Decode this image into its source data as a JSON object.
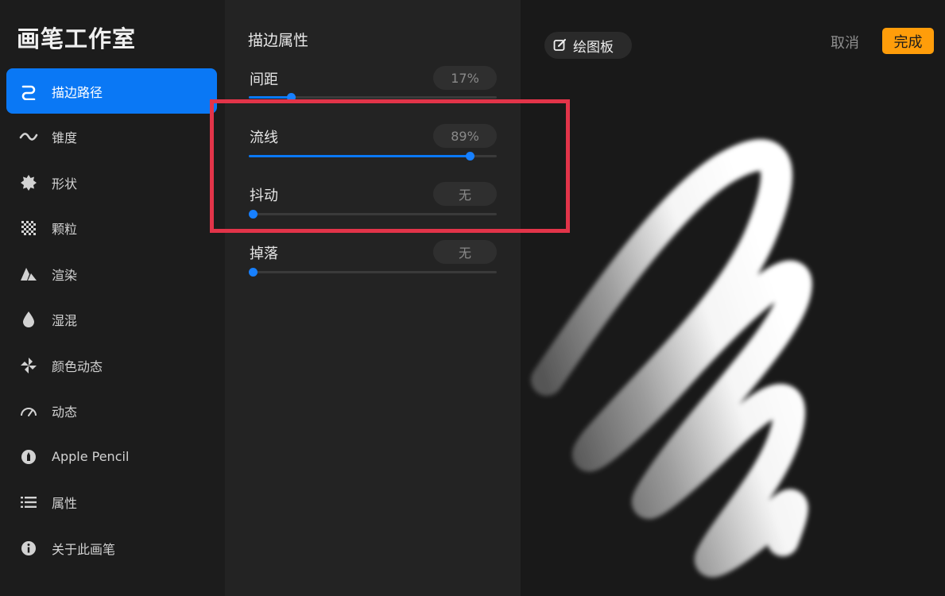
{
  "app_title": "画笔工作室",
  "sidebar": {
    "items": [
      {
        "label": "描边路径",
        "icon": "stroke-path-icon",
        "active": true
      },
      {
        "label": "锥度",
        "icon": "taper-icon"
      },
      {
        "label": "形状",
        "icon": "shape-icon"
      },
      {
        "label": "颗粒",
        "icon": "grain-icon"
      },
      {
        "label": "渲染",
        "icon": "render-icon"
      },
      {
        "label": "湿混",
        "icon": "wet-mix-icon"
      },
      {
        "label": "颜色动态",
        "icon": "color-dynamics-icon"
      },
      {
        "label": "动态",
        "icon": "dynamics-icon"
      },
      {
        "label": "Apple Pencil",
        "icon": "apple-pencil-icon"
      },
      {
        "label": "属性",
        "icon": "properties-icon"
      },
      {
        "label": "关于此画笔",
        "icon": "about-icon"
      }
    ]
  },
  "panel": {
    "title": "描边属性",
    "params": [
      {
        "label": "间距",
        "value": "17%",
        "level": 0.17
      },
      {
        "label": "流线",
        "value": "89%",
        "level": 0.89
      },
      {
        "label": "抖动",
        "value": "无",
        "level": 0
      },
      {
        "label": "掉落",
        "value": "无",
        "level": 0
      }
    ]
  },
  "toolbar": {
    "drawing_pad_label": "绘图板",
    "cancel_label": "取消",
    "done_label": "完成"
  },
  "colors": {
    "accent": "#0a78f5",
    "done": "#ff9d0a",
    "highlight": "#e23449"
  }
}
